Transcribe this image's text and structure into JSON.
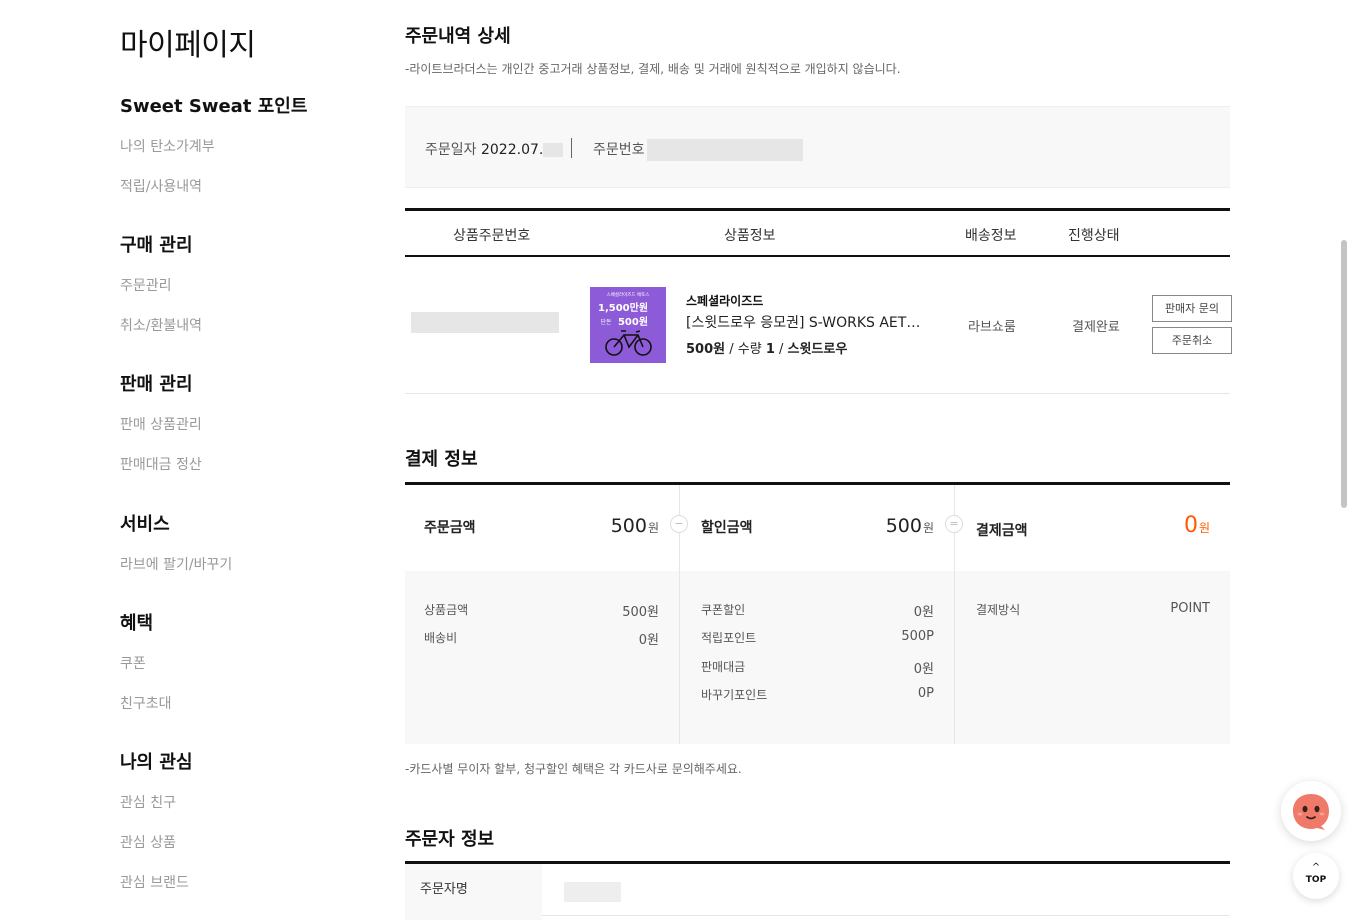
{
  "sidebar": {
    "title": "마이페이지",
    "groups": [
      {
        "heading": "Sweet Sweat 포인트",
        "items": [
          "나의 탄소가계부",
          "적립/사용내역"
        ]
      },
      {
        "heading": "구매 관리",
        "items": [
          "주문관리",
          "취소/환불내역"
        ]
      },
      {
        "heading": "판매 관리",
        "items": [
          "판매 상품관리",
          "판매대금 정산"
        ]
      },
      {
        "heading": "서비스",
        "items": [
          "라브에 팔기/바꾸기"
        ]
      },
      {
        "heading": "혜택",
        "items": [
          "쿠폰",
          "친구초대"
        ]
      },
      {
        "heading": "나의 관심",
        "items": [
          "관심 친구",
          "관심 상품",
          "관심 브랜드"
        ]
      }
    ]
  },
  "order_detail": {
    "title": "주문내역 상세",
    "notice": "-라이트브라더스는 개인간 중고거래 상품정보, 결제, 배송 및 거래에 원칙적으로 개입하지 않습니다.",
    "order_date_label": "주문일자",
    "order_date_value": "2022.07.",
    "order_no_label": "주문번호"
  },
  "product_table": {
    "headers": [
      "상품주문번호",
      "상품정보",
      "배송정보",
      "진행상태"
    ],
    "row": {
      "seller": "스페셜라이즈드",
      "name": "[스윗드로우 응모권] S-WORKS AETHOS",
      "price": "500원",
      "qty_label": " / 수량 ",
      "qty": "1",
      "sep": " / ",
      "brand": "스윗드로우",
      "shipping": "라브쇼룸",
      "status": "결제완료",
      "thumb_top": "스페셜라이즈드 에토스",
      "thumb_big": "1,500만원",
      "thumb_sub": "단돈",
      "thumb_price": "500원",
      "btn_inquiry": "판매자 문의",
      "btn_cancel": "주문취소"
    }
  },
  "payment": {
    "title": "결제 정보",
    "order_amount_label": "주문금액",
    "order_amount": "500",
    "discount_label": "할인금액",
    "discount_amount": "500",
    "final_label": "결제금액",
    "final_amount": "0",
    "won": "원",
    "minus": "−",
    "equals": "=",
    "sub_left": [
      {
        "label": "상품금액",
        "value": "500원"
      },
      {
        "label": "배송비",
        "value": "0원"
      }
    ],
    "sub_mid": [
      {
        "label": "쿠폰할인",
        "value": "0원"
      },
      {
        "label": "적립포인트",
        "value": "500P"
      },
      {
        "label": "판매대금",
        "value": "0원"
      },
      {
        "label": "바꾸기포인트",
        "value": "0P"
      }
    ],
    "method_label": "결제방식",
    "method_value": "POINT",
    "card_notice": "-카드사별 무이자 할부, 청구할인 혜택은 각 카드사로 문의해주세요."
  },
  "orderer": {
    "title": "주문자 정보",
    "name_label": "주문자명"
  },
  "floating": {
    "top_label": "TOP",
    "top_arrow": "^"
  },
  "colors": {
    "accent_orange": "#ff5a00",
    "thumb_purple": "#8e5bd8",
    "chat_face": "#f07a6a"
  }
}
